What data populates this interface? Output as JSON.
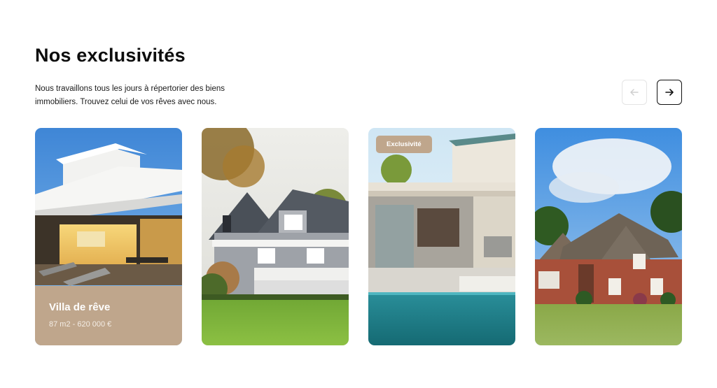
{
  "section": {
    "title": "Nos exclusivités",
    "description": "Nous travaillons tous les jours à répertorier des biens immobiliers. Trouvez celui de vos rêves avec nous."
  },
  "navigation": {
    "prev_icon": "arrow-left-icon",
    "next_icon": "arrow-right-icon",
    "prev_disabled": true
  },
  "cards": [
    {
      "image": "villa-terrace-photo",
      "title": "Villa de rêve",
      "details": "87 m2 - 620 000 €"
    },
    {
      "image": "shingle-house-photo"
    },
    {
      "image": "modern-pool-house-photo",
      "badge": "Exclusivité"
    },
    {
      "image": "brick-house-photo"
    }
  ],
  "colors": {
    "accent": "#bfa68c",
    "text": "#111111",
    "background": "#ffffff"
  }
}
